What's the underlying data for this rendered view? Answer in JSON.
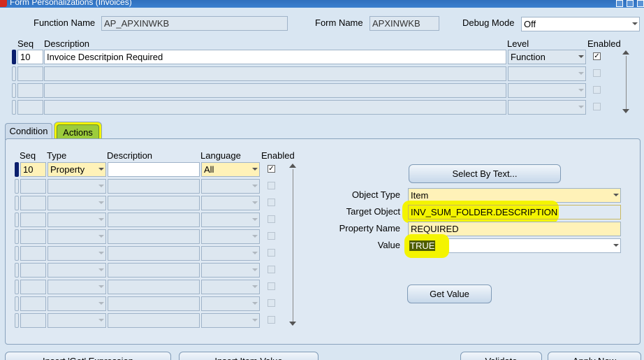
{
  "window": {
    "title": "Form Personalizations (Invoices)"
  },
  "header": {
    "function_name_label": "Function Name",
    "function_name_value": "AP_APXINWKB",
    "form_name_label": "Form Name",
    "form_name_value": "APXINWKB",
    "debug_mode_label": "Debug Mode",
    "debug_mode_value": "Off"
  },
  "rules": {
    "col_seq": "Seq",
    "col_description": "Description",
    "col_level": "Level",
    "col_enabled": "Enabled",
    "rows": [
      {
        "seq": "10",
        "description": "Invoice Descritpion Required",
        "level": "Function",
        "enabled": true
      }
    ]
  },
  "tabs": {
    "condition": "Condition",
    "actions": "Actions",
    "active": "Actions"
  },
  "actions": {
    "col_seq": "Seq",
    "col_type": "Type",
    "col_description": "Description",
    "col_language": "Language",
    "col_enabled": "Enabled",
    "rows": [
      {
        "seq": "10",
        "type": "Property",
        "description": "",
        "language": "All",
        "enabled": true
      }
    ]
  },
  "details": {
    "select_by_text_button": "Select By Text...",
    "object_type_label": "Object Type",
    "object_type_value": "Item",
    "target_object_label": "Target Object",
    "target_object_value": "INV_SUM_FOLDER.DESCRIPTION",
    "property_name_label": "Property Name",
    "property_name_value": "REQUIRED",
    "value_label": "Value",
    "value_value": "TRUE",
    "get_value_button": "Get Value"
  },
  "bottom_buttons": {
    "insert_get_expression": "Insert 'Get' Expression",
    "insert_item_value": "Insert Item Value",
    "validate": "Validate",
    "apply_now": "Apply Now"
  },
  "highlight_color": "#f4f400"
}
